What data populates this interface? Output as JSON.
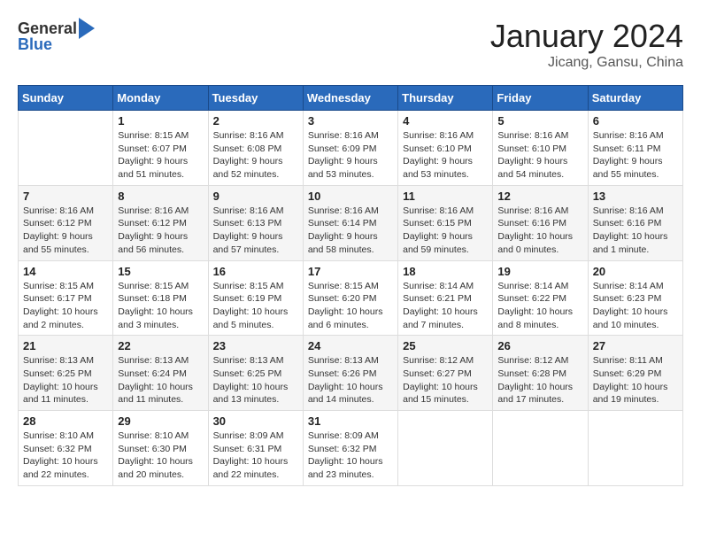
{
  "header": {
    "logo_general": "General",
    "logo_blue": "Blue",
    "month_title": "January 2024",
    "location": "Jicang, Gansu, China"
  },
  "weekdays": [
    "Sunday",
    "Monday",
    "Tuesday",
    "Wednesday",
    "Thursday",
    "Friday",
    "Saturday"
  ],
  "weeks": [
    [
      {
        "day": "",
        "info": ""
      },
      {
        "day": "1",
        "info": "Sunrise: 8:15 AM\nSunset: 6:07 PM\nDaylight: 9 hours\nand 51 minutes."
      },
      {
        "day": "2",
        "info": "Sunrise: 8:16 AM\nSunset: 6:08 PM\nDaylight: 9 hours\nand 52 minutes."
      },
      {
        "day": "3",
        "info": "Sunrise: 8:16 AM\nSunset: 6:09 PM\nDaylight: 9 hours\nand 53 minutes."
      },
      {
        "day": "4",
        "info": "Sunrise: 8:16 AM\nSunset: 6:10 PM\nDaylight: 9 hours\nand 53 minutes."
      },
      {
        "day": "5",
        "info": "Sunrise: 8:16 AM\nSunset: 6:10 PM\nDaylight: 9 hours\nand 54 minutes."
      },
      {
        "day": "6",
        "info": "Sunrise: 8:16 AM\nSunset: 6:11 PM\nDaylight: 9 hours\nand 55 minutes."
      }
    ],
    [
      {
        "day": "7",
        "info": ""
      },
      {
        "day": "8",
        "info": "Sunrise: 8:16 AM\nSunset: 6:12 PM\nDaylight: 9 hours\nand 56 minutes."
      },
      {
        "day": "9",
        "info": "Sunrise: 8:16 AM\nSunset: 6:13 PM\nDaylight: 9 hours\nand 57 minutes."
      },
      {
        "day": "10",
        "info": "Sunrise: 8:16 AM\nSunset: 6:14 PM\nDaylight: 9 hours\nand 58 minutes."
      },
      {
        "day": "11",
        "info": "Sunrise: 8:16 AM\nSunset: 6:15 PM\nDaylight: 9 hours\nand 59 minutes."
      },
      {
        "day": "12",
        "info": "Sunrise: 8:16 AM\nSunset: 6:16 PM\nDaylight: 10 hours\nand 0 minutes."
      },
      {
        "day": "13",
        "info": "Sunrise: 8:16 AM\nSunset: 6:16 PM\nDaylight: 10 hours\nand 1 minute."
      }
    ],
    [
      {
        "day": "14",
        "info": ""
      },
      {
        "day": "15",
        "info": "Sunrise: 8:15 AM\nSunset: 6:18 PM\nDaylight: 10 hours\nand 3 minutes."
      },
      {
        "day": "16",
        "info": "Sunrise: 8:15 AM\nSunset: 6:19 PM\nDaylight: 10 hours\nand 5 minutes."
      },
      {
        "day": "17",
        "info": "Sunrise: 8:15 AM\nSunset: 6:20 PM\nDaylight: 10 hours\nand 6 minutes."
      },
      {
        "day": "18",
        "info": "Sunrise: 8:14 AM\nSunset: 6:21 PM\nDaylight: 10 hours\nand 7 minutes."
      },
      {
        "day": "19",
        "info": "Sunrise: 8:14 AM\nSunset: 6:22 PM\nDaylight: 10 hours\nand 8 minutes."
      },
      {
        "day": "20",
        "info": "Sunrise: 8:14 AM\nSunset: 6:23 PM\nDaylight: 10 hours\nand 10 minutes."
      }
    ],
    [
      {
        "day": "21",
        "info": ""
      },
      {
        "day": "22",
        "info": "Sunrise: 8:13 AM\nSunset: 6:24 PM\nDaylight: 10 hours\nand 11 minutes."
      },
      {
        "day": "23",
        "info": "Sunrise: 8:13 AM\nSunset: 6:25 PM\nDaylight: 10 hours\nand 13 minutes."
      },
      {
        "day": "24",
        "info": "Sunrise: 8:13 AM\nSunset: 6:26 PM\nDaylight: 10 hours\nand 14 minutes."
      },
      {
        "day": "25",
        "info": "Sunrise: 8:12 AM\nSunset: 6:27 PM\nDaylight: 10 hours\nand 15 minutes."
      },
      {
        "day": "26",
        "info": "Sunrise: 8:12 AM\nSunset: 6:28 PM\nDaylight: 10 hours\nand 17 minutes."
      },
      {
        "day": "27",
        "info": "Sunrise: 8:11 AM\nSunset: 6:29 PM\nDaylight: 10 hours\nand 19 minutes."
      }
    ],
    [
      {
        "day": "28",
        "info": ""
      },
      {
        "day": "29",
        "info": "Sunrise: 8:10 AM\nSunset: 6:30 PM\nDaylight: 10 hours\nand 20 minutes."
      },
      {
        "day": "30",
        "info": "Sunrise: 8:09 AM\nSunset: 6:31 PM\nDaylight: 10 hours\nand 22 minutes."
      },
      {
        "day": "31",
        "info": "Sunrise: 8:09 AM\nSunset: 6:32 PM\nDaylight: 10 hours\nand 23 minutes."
      },
      {
        "day": "",
        "info": ""
      },
      {
        "day": "",
        "info": ""
      },
      {
        "day": "",
        "info": ""
      }
    ]
  ],
  "week1_col0_info": "Sunrise: 8:15 AM\nSunset: 6:07 PM\nDaylight: 9 hours\nand 51 minutes.",
  "week2_col0_info": "Sunrise: 8:16 AM\nSunset: 6:12 PM\nDaylight: 9 hours\nand 55 minutes.",
  "week3_col0_info": "Sunrise: 8:15 AM\nSunset: 6:17 PM\nDaylight: 10 hours\nand 2 minutes.",
  "week4_col0_info": "Sunrise: 8:13 AM\nSunset: 6:25 PM\nDaylight: 10 hours\nand 11 minutes.",
  "week5_col0_info": "Sunrise: 8:10 AM\nSunset: 6:32 PM\nDaylight: 10 hours\nand 22 minutes."
}
